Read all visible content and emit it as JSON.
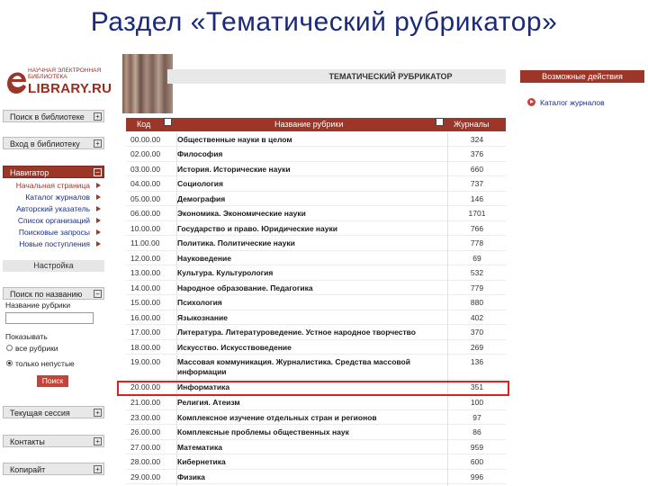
{
  "slide": {
    "title": "Раздел «Тематический  рубрикатор»"
  },
  "logo": {
    "small": "НАУЧНАЯ ЭЛЕКТРОННАЯ БИБЛИОТЕКА",
    "big": "LIBRARY.RU",
    "color": "#9c3629"
  },
  "sidebar": {
    "search_library": "Поиск в библиотеке",
    "login": "Вход в библиотеку",
    "navigator": "Навигатор",
    "nav_items": [
      "Начальная страница",
      "Каталог журналов",
      "Авторский указатель",
      "Список организаций",
      "Поисковые запросы",
      "Новые поступления"
    ],
    "settings": "Настройка",
    "search_by_name": "Поиск по названию",
    "rubric_label": "Название рубрики",
    "show_label": "Показывать",
    "radio_all": "все рубрики",
    "radio_nonempty": "только непустые",
    "search_button": "Поиск",
    "session": "Текущая сессия",
    "contacts": "Контакты",
    "copyright": "Копирайт"
  },
  "banner": {
    "title": "ТЕМАТИЧЕСКИЙ РУБРИКАТОР"
  },
  "table": {
    "headers": {
      "code": "Код",
      "name": "Название рубрики",
      "journals": "Журналы"
    },
    "rows": [
      {
        "code": "00.00.00",
        "name": "Общественные науки в целом",
        "count": "324"
      },
      {
        "code": "02.00.00",
        "name": "Философия",
        "count": "376"
      },
      {
        "code": "03.00.00",
        "name": "История. Исторические науки",
        "count": "660"
      },
      {
        "code": "04.00.00",
        "name": "Социология",
        "count": "737"
      },
      {
        "code": "05.00.00",
        "name": "Демография",
        "count": "146"
      },
      {
        "code": "06.00.00",
        "name": "Экономика. Экономические науки",
        "count": "1701"
      },
      {
        "code": "10.00.00",
        "name": "Государство и право. Юридические науки",
        "count": "766"
      },
      {
        "code": "11.00.00",
        "name": "Политика. Политические науки",
        "count": "778"
      },
      {
        "code": "12.00.00",
        "name": "Науковедение",
        "count": "69"
      },
      {
        "code": "13.00.00",
        "name": "Культура. Культурология",
        "count": "532"
      },
      {
        "code": "14.00.00",
        "name": "Народное образование. Педагогика",
        "count": "779"
      },
      {
        "code": "15.00.00",
        "name": "Психология",
        "count": "880"
      },
      {
        "code": "16.00.00",
        "name": "Языкознание",
        "count": "402"
      },
      {
        "code": "17.00.00",
        "name": "Литература. Литературоведение. Устное народное творчество",
        "count": "370"
      },
      {
        "code": "18.00.00",
        "name": "Искусство. Искусствоведение",
        "count": "269"
      },
      {
        "code": "19.00.00",
        "name": "Массовая коммуникация. Журналистика. Средства массовой информации",
        "count": "136"
      },
      {
        "code": "20.00.00",
        "name": "Информатика",
        "count": "351"
      },
      {
        "code": "21.00.00",
        "name": "Религия. Атеизм",
        "count": "100"
      },
      {
        "code": "23.00.00",
        "name": "Комплексное изучение отдельных стран и регионов",
        "count": "97"
      },
      {
        "code": "26.00.00",
        "name": "Комплексные проблемы общественных наук",
        "count": "86"
      },
      {
        "code": "27.00.00",
        "name": "Математика",
        "count": "959"
      },
      {
        "code": "28.00.00",
        "name": "Кибернетика",
        "count": "600"
      },
      {
        "code": "29.00.00",
        "name": "Физика",
        "count": "996"
      }
    ]
  },
  "right_panel": {
    "title": "Возможные действия",
    "link": "Каталог журналов"
  },
  "colors": {
    "accent": "#9c3629",
    "highlight": "#e0201a",
    "link": "#1c2f86"
  }
}
